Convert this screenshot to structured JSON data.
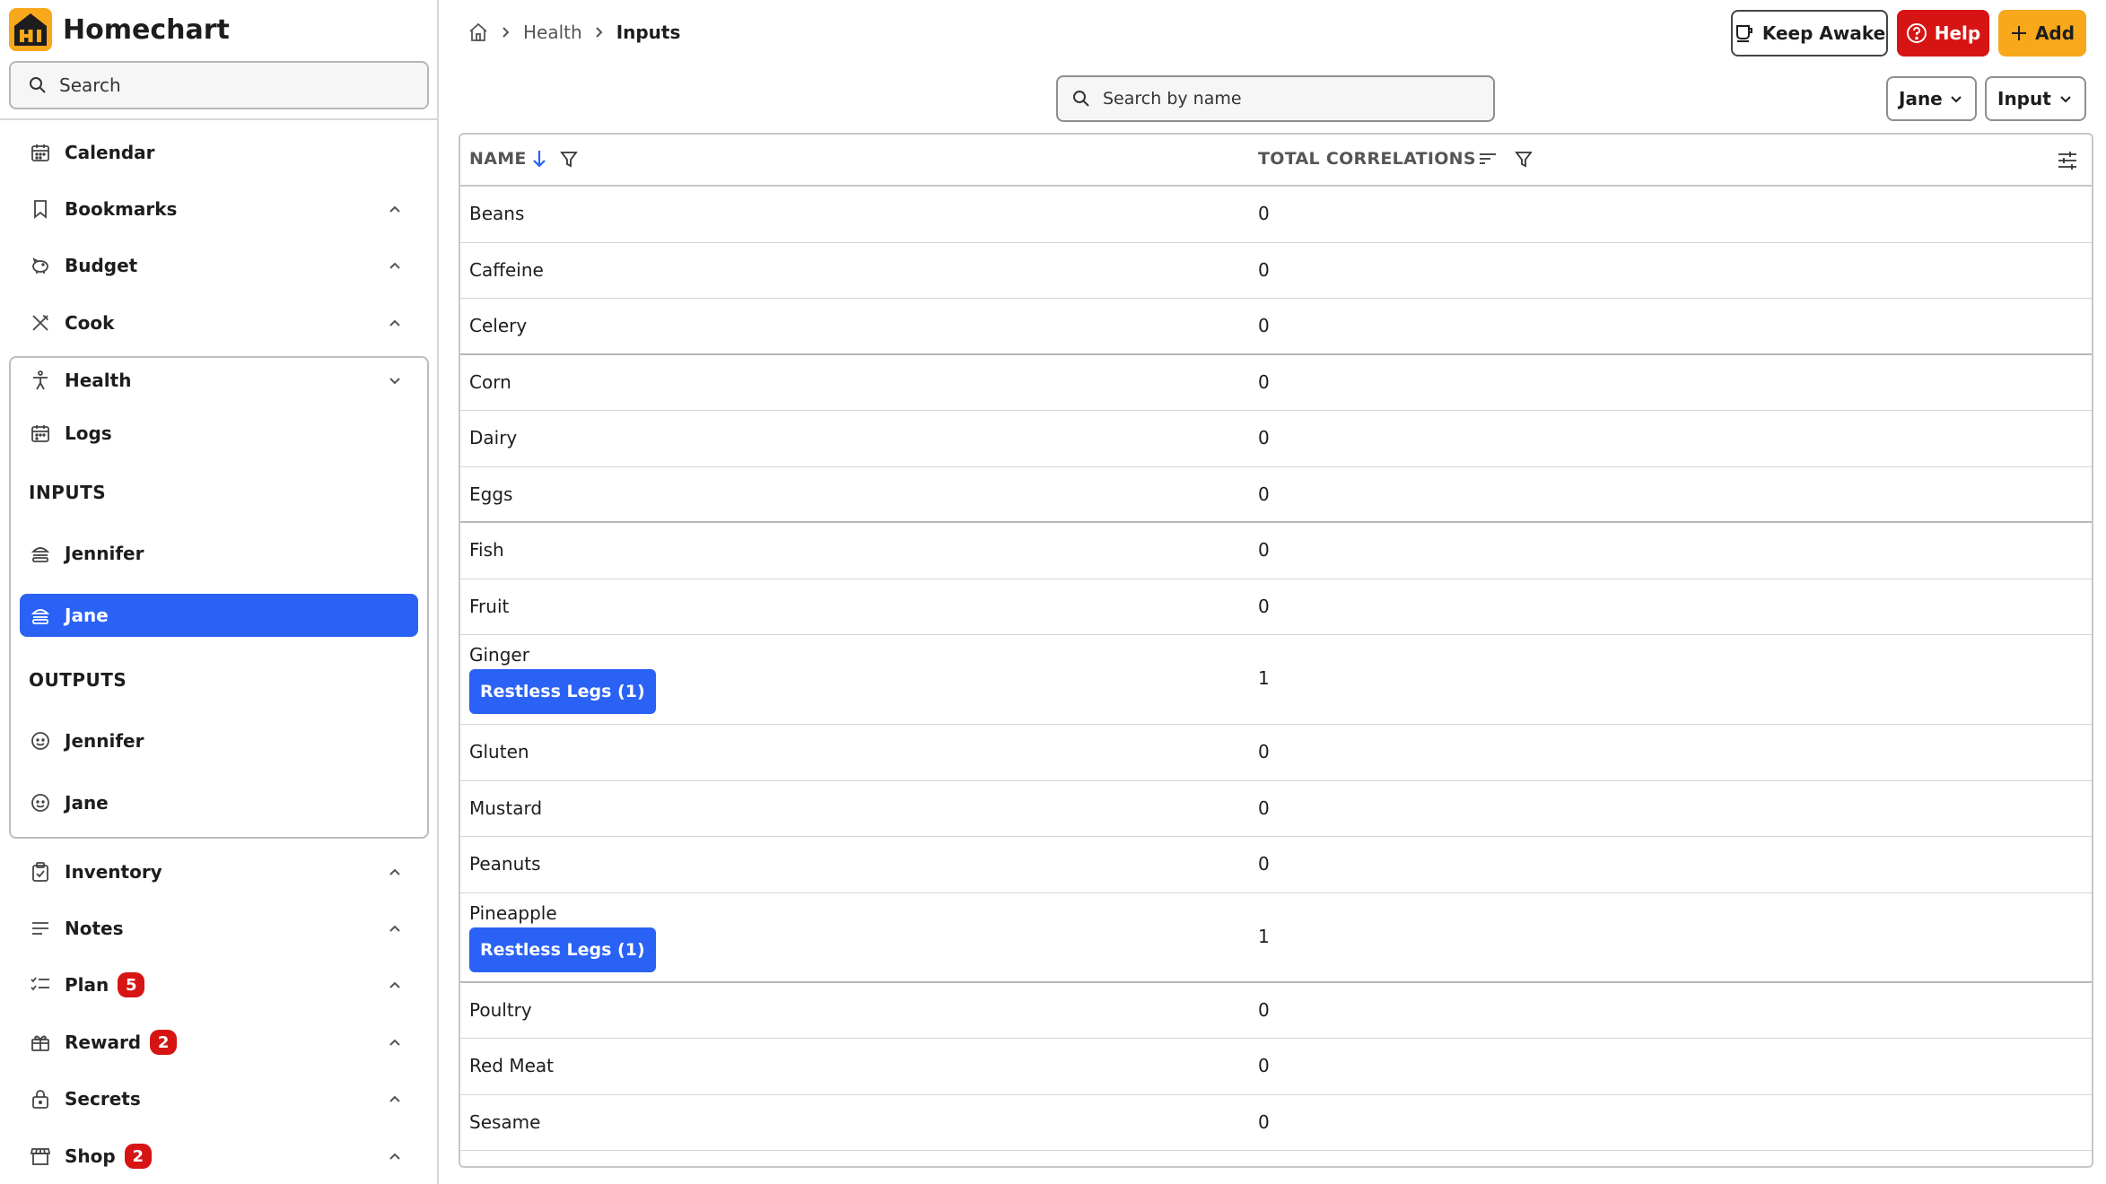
{
  "app": {
    "title": "Homechart"
  },
  "sidebar": {
    "search_label": "Search",
    "items": {
      "calendar": "Calendar",
      "bookmarks": "Bookmarks",
      "budget": "Budget",
      "cook": "Cook",
      "health": "Health",
      "logs": "Logs",
      "inventory": "Inventory",
      "notes": "Notes",
      "plan": "Plan",
      "reward": "Reward",
      "secrets": "Secrets",
      "shop": "Shop"
    },
    "badges": {
      "plan": "5",
      "reward": "2",
      "shop": "2"
    },
    "inputs_label": "INPUTS",
    "outputs_label": "OUTPUTS",
    "inputs": [
      "Jennifer",
      "Jane"
    ],
    "outputs": [
      "Jennifer",
      "Jane"
    ],
    "selected": "Jane"
  },
  "breadcrumb": {
    "section": "Health",
    "current": "Inputs"
  },
  "toolbar": {
    "keep_awake": "Keep Awake",
    "help": "Help",
    "add": "Add"
  },
  "filters": {
    "search_placeholder": "Search by name",
    "person": "Jane",
    "type": "Input"
  },
  "table": {
    "headers": {
      "name": "NAME",
      "total_correlations": "TOTAL CORRELATIONS"
    },
    "rows": [
      {
        "name": "Beans",
        "count": "0"
      },
      {
        "name": "Caffeine",
        "count": "0"
      },
      {
        "name": "Celery",
        "count": "0"
      },
      {
        "name": "Corn",
        "count": "0"
      },
      {
        "name": "Dairy",
        "count": "0"
      },
      {
        "name": "Eggs",
        "count": "0"
      },
      {
        "name": "Fish",
        "count": "0"
      },
      {
        "name": "Fruit",
        "count": "0"
      },
      {
        "name": "Ginger",
        "count": "1",
        "tag": "Restless Legs (1)"
      },
      {
        "name": "Gluten",
        "count": "0"
      },
      {
        "name": "Mustard",
        "count": "0"
      },
      {
        "name": "Peanuts",
        "count": "0"
      },
      {
        "name": "Pineapple",
        "count": "1",
        "tag": "Restless Legs (1)"
      },
      {
        "name": "Poultry",
        "count": "0"
      },
      {
        "name": "Red Meat",
        "count": "0"
      },
      {
        "name": "Sesame",
        "count": "0"
      }
    ]
  },
  "colors": {
    "accent": "#2a62f5",
    "danger": "#d71414",
    "warning": "#f7a81b",
    "logo": "#f7a81b"
  }
}
